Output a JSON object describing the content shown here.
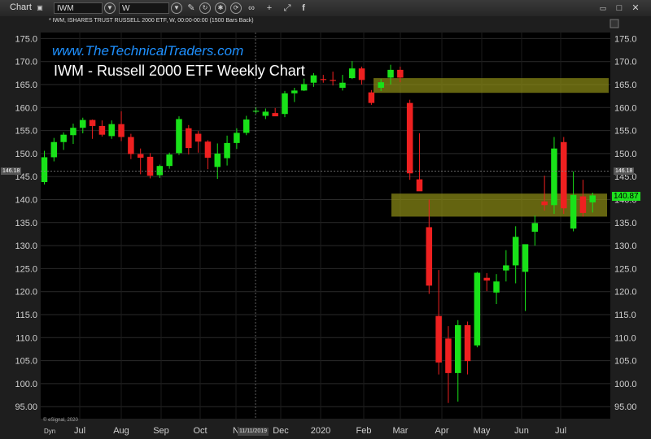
{
  "toolbar": {
    "chart_label": "Chart",
    "symbol_value": "IWM",
    "interval_value": "W"
  },
  "header": "* IWM, ISHARES TRUST RUSSELL 2000 ETF, W, 00:00-00:00 (1500 Bars Back)",
  "watermark": "www.TheTechnicalTraders.com",
  "title": "IWM - Russell 2000 ETF Weekly Chart",
  "copyright": "© eSignal, 2020",
  "dyn_label": "Dyn",
  "crosshair": {
    "date_label": "11/11/2019",
    "price_label": "146.18",
    "price": 146.18
  },
  "last_price_label": "140.87",
  "colors": {
    "up": "#19e219",
    "down": "#ee2020",
    "zone": "#8a8a16",
    "background": "#000000",
    "brand": "#1e90ff"
  },
  "chart_data": {
    "type": "candlestick",
    "ylim": [
      92,
      177
    ],
    "y_ticks": [
      "95.00",
      "100.0",
      "105.0",
      "110.0",
      "115.0",
      "120.0",
      "125.0",
      "130.0",
      "135.0",
      "140.0",
      "145.0",
      "150.0",
      "155.0",
      "160.0",
      "165.0",
      "170.0",
      "175.0"
    ],
    "x_ticks": [
      "Jul",
      "Aug",
      "Sep",
      "Oct",
      "N",
      "Dec",
      "2020",
      "Feb",
      "Mar",
      "Apr",
      "May",
      "Jun",
      "Jul"
    ],
    "zones": [
      {
        "from": 163.2,
        "to": 166.4
      },
      {
        "from": 136.3,
        "to": 141.3
      }
    ],
    "candles": [
      {
        "o": 143.8,
        "h": 150.6,
        "l": 143.3,
        "c": 149.2
      },
      {
        "o": 149.2,
        "h": 153.4,
        "l": 148.3,
        "c": 152.5
      },
      {
        "o": 152.5,
        "h": 154.6,
        "l": 150.8,
        "c": 154.1
      },
      {
        "o": 154.0,
        "h": 156.5,
        "l": 152.1,
        "c": 155.6
      },
      {
        "o": 155.6,
        "h": 157.8,
        "l": 154.4,
        "c": 157.3
      },
      {
        "o": 157.3,
        "h": 157.4,
        "l": 153.2,
        "c": 156.0
      },
      {
        "o": 156.0,
        "h": 157.2,
        "l": 153.7,
        "c": 154.1
      },
      {
        "o": 153.8,
        "h": 157.2,
        "l": 153.2,
        "c": 156.4
      },
      {
        "o": 156.4,
        "h": 159.2,
        "l": 152.7,
        "c": 153.6
      },
      {
        "o": 153.6,
        "h": 154.3,
        "l": 148.8,
        "c": 149.9
      },
      {
        "o": 149.9,
        "h": 151.1,
        "l": 145.5,
        "c": 149.1
      },
      {
        "o": 149.3,
        "h": 150.1,
        "l": 144.6,
        "c": 145.2
      },
      {
        "o": 145.3,
        "h": 147.6,
        "l": 144.7,
        "c": 147.3
      },
      {
        "o": 147.3,
        "h": 150.2,
        "l": 146.7,
        "c": 149.8
      },
      {
        "o": 150.1,
        "h": 158.1,
        "l": 149.7,
        "c": 157.5
      },
      {
        "o": 155.5,
        "h": 156.2,
        "l": 149.8,
        "c": 151.2
      },
      {
        "o": 154.3,
        "h": 154.9,
        "l": 150.2,
        "c": 152.6
      },
      {
        "o": 152.6,
        "h": 152.9,
        "l": 146.6,
        "c": 149.1
      },
      {
        "o": 147.1,
        "h": 152.2,
        "l": 144.5,
        "c": 150.0
      },
      {
        "o": 149.0,
        "h": 153.9,
        "l": 147.4,
        "c": 152.3
      },
      {
        "o": 152.3,
        "h": 155.5,
        "l": 151.0,
        "c": 154.5
      },
      {
        "o": 154.5,
        "h": 158.2,
        "l": 154.0,
        "c": 157.4
      },
      {
        "o": 159.3,
        "h": 160.1,
        "l": 158.7,
        "c": 159.3
      },
      {
        "o": 158.2,
        "h": 159.8,
        "l": 157.5,
        "c": 159.1
      },
      {
        "o": 158.8,
        "h": 159.9,
        "l": 158.3,
        "c": 158.1
      },
      {
        "o": 158.6,
        "h": 163.6,
        "l": 157.9,
        "c": 163.1
      },
      {
        "o": 163.1,
        "h": 164.3,
        "l": 161.2,
        "c": 163.7
      },
      {
        "o": 163.7,
        "h": 166.3,
        "l": 163.6,
        "c": 165.1
      },
      {
        "o": 165.4,
        "h": 167.5,
        "l": 164.5,
        "c": 167.0
      },
      {
        "o": 166.2,
        "h": 167.1,
        "l": 165.4,
        "c": 166.0
      },
      {
        "o": 166.0,
        "h": 167.8,
        "l": 164.8,
        "c": 165.8
      },
      {
        "o": 164.3,
        "h": 167.1,
        "l": 163.7,
        "c": 165.4
      },
      {
        "o": 166.4,
        "h": 170.1,
        "l": 166.2,
        "c": 168.5
      },
      {
        "o": 168.5,
        "h": 168.9,
        "l": 165.0,
        "c": 166.0
      },
      {
        "o": 163.3,
        "h": 163.8,
        "l": 160.6,
        "c": 161.0
      },
      {
        "o": 164.3,
        "h": 166.2,
        "l": 163.6,
        "c": 165.5
      },
      {
        "o": 166.5,
        "h": 169.3,
        "l": 165.0,
        "c": 168.2
      },
      {
        "o": 168.2,
        "h": 168.9,
        "l": 165.5,
        "c": 166.5
      },
      {
        "o": 161.0,
        "h": 161.7,
        "l": 144.3,
        "c": 145.7
      },
      {
        "o": 144.4,
        "h": 154.4,
        "l": 142.5,
        "c": 141.8
      },
      {
        "o": 134.0,
        "h": 140.0,
        "l": 119.5,
        "c": 121.3
      },
      {
        "o": 114.7,
        "h": 124.7,
        "l": 102.0,
        "c": 104.6
      },
      {
        "o": 109.8,
        "h": 112.5,
        "l": 95.8,
        "c": 102.3
      },
      {
        "o": 102.3,
        "h": 113.8,
        "l": 96.1,
        "c": 112.7
      },
      {
        "o": 112.7,
        "h": 113.5,
        "l": 102.0,
        "c": 104.9
      },
      {
        "o": 108.3,
        "h": 124.3,
        "l": 107.9,
        "c": 124.1
      },
      {
        "o": 123.0,
        "h": 124.0,
        "l": 120.1,
        "c": 122.4
      },
      {
        "o": 119.8,
        "h": 123.8,
        "l": 117.3,
        "c": 122.2
      },
      {
        "o": 124.6,
        "h": 129.0,
        "l": 122.2,
        "c": 125.7
      },
      {
        "o": 125.7,
        "h": 134.2,
        "l": 121.8,
        "c": 131.9
      },
      {
        "o": 124.3,
        "h": 129.8,
        "l": 115.8,
        "c": 130.3
      },
      {
        "o": 133.0,
        "h": 136.5,
        "l": 130.0,
        "c": 134.9
      },
      {
        "o": 139.6,
        "h": 145.2,
        "l": 137.6,
        "c": 138.8
      },
      {
        "o": 138.8,
        "h": 153.6,
        "l": 136.9,
        "c": 151.1
      },
      {
        "o": 152.5,
        "h": 153.6,
        "l": 136.9,
        "c": 138.1
      },
      {
        "o": 133.7,
        "h": 146.1,
        "l": 133.1,
        "c": 141.0
      },
      {
        "o": 140.7,
        "h": 144.3,
        "l": 136.3,
        "c": 137.1
      },
      {
        "o": 139.4,
        "h": 141.5,
        "l": 137.2,
        "c": 140.9
      }
    ]
  }
}
